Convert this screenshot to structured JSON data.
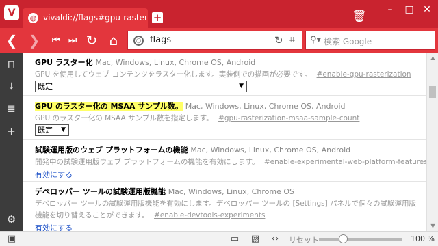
{
  "tab": {
    "title": "vivaldi://flags#gpu-rasterization"
  },
  "address": {
    "text": "flags"
  },
  "search": {
    "placeholder": "検索 Google"
  },
  "flags": [
    {
      "title": "GPU ラスター化",
      "platforms": "Mac, Windows, Linux, Chrome OS, Android",
      "description": "GPU を使用してウェブ コンテンツをラスター化します。実装側での描画が必要です。",
      "id": "#enable-gpu-rasterization",
      "select_value": "既定"
    },
    {
      "title": "GPU のラスター化の MSAA サンプル数。",
      "platforms": "Mac, Windows, Linux, Chrome OS, Android",
      "description": "GPU のラスター化の MSAA サンプル数を指定します。",
      "id": "#gpu-rasterization-msaa-sample-count",
      "select_value": "既定"
    },
    {
      "title": "試験運用版のウェブ プラットフォームの機能",
      "platforms": "Mac, Windows, Linux, Chrome OS, Android",
      "description": "開発中の試験運用版ウェブ プラットフォームの機能を有効にします。",
      "id": "#enable-experimental-web-platform-features",
      "link": "有効にする"
    },
    {
      "title": "デベロッパー ツールの試験運用版機能",
      "platforms": "Mac, Windows, Linux, Chrome OS",
      "description": "デベロッパー ツールの試験運用版機能を有効にします。デベロッパー ツールの [Settings] パネルで個々の試験運用版",
      "description2": "機能を切り替えることができます。",
      "id": "#enable-devtools-experiments",
      "link": "有効にする"
    }
  ],
  "status": {
    "reset": "リセット",
    "zoom": "100 %",
    "zoom_level": 0.25
  },
  "colors": {
    "accent": "#c9232f",
    "toolbar": "#e3363d",
    "highlight": "#ffff66",
    "link": "#1a4fc7"
  },
  "icons": {
    "logo": "vivaldi-logo",
    "back": "back-arrow-icon",
    "forward": "forward-arrow-icon",
    "rewind": "rewind-icon",
    "fastforward": "fast-forward-icon",
    "reload": "reload-icon",
    "home": "home-icon"
  }
}
